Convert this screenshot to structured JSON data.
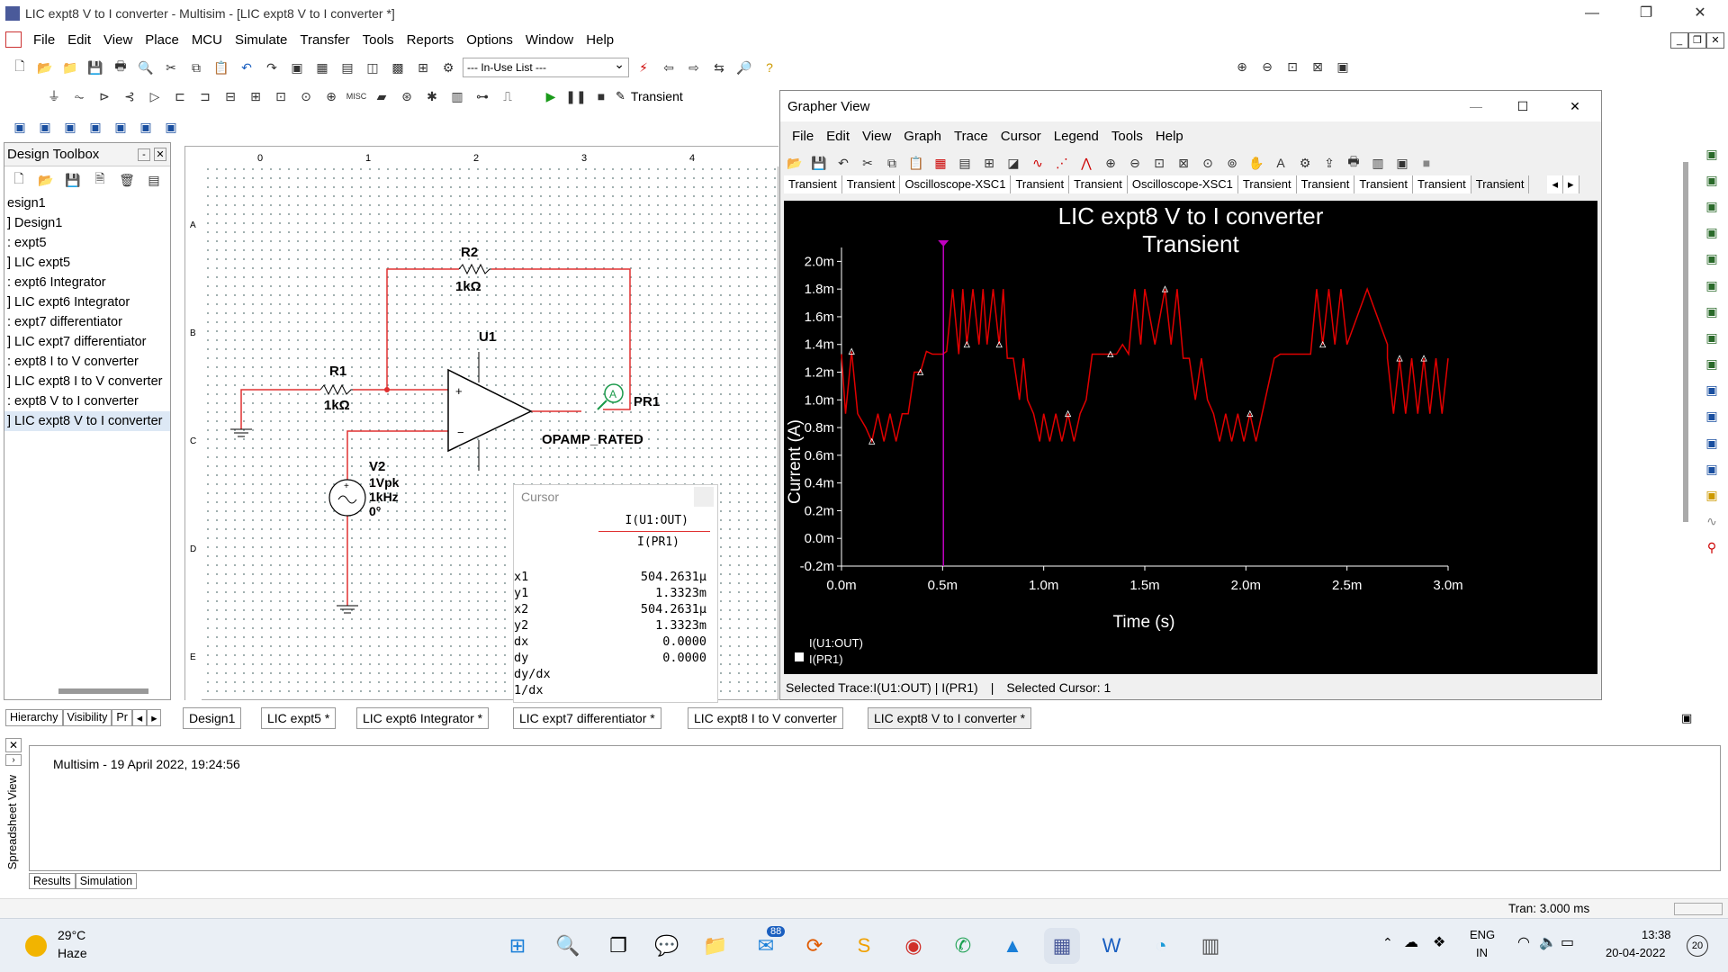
{
  "window": {
    "title": "LIC expt8 V to I converter - Multisim - [LIC expt8 V to I converter *]"
  },
  "menu": [
    "File",
    "Edit",
    "View",
    "Place",
    "MCU",
    "Simulate",
    "Transfer",
    "Tools",
    "Reports",
    "Options",
    "Window",
    "Help"
  ],
  "toolbar": {
    "inuse": "--- In-Use List ---",
    "analysis": "Transient"
  },
  "toolbox": {
    "title": "Design Toolbox",
    "items": [
      "esign1",
      "] Design1",
      ": expt5",
      "] LIC expt5",
      ": expt6 Integrator",
      "] LIC expt6 Integrator",
      ": expt7 differentiator",
      "] LIC expt7 differentiator",
      ": expt8 I to V converter",
      "] LIC expt8 I to V converter",
      ": expt8 V to I converter",
      "] LIC expt8 V to I converter"
    ],
    "tabs": [
      "Hierarchy",
      "Visibility",
      "Pr"
    ]
  },
  "schematic": {
    "r2": "R2",
    "r2v": "1kΩ",
    "r1": "R1",
    "r1v": "1kΩ",
    "u1": "U1",
    "opamp": "OPAMP_RATED",
    "pr1": "PR1",
    "v2": "V2",
    "v2a": "1Vpk",
    "v2b": "1kHz",
    "v2c": "0°",
    "probe": "A",
    "rulers": [
      "0",
      "1",
      "2",
      "3",
      "4"
    ],
    "rows": [
      "A",
      "B",
      "C",
      "D",
      "E"
    ]
  },
  "cursor": {
    "title": "Cursor",
    "col1": "I(U1:OUT)",
    "col2": "I(PR1)",
    "rows": [
      {
        "k": "x1",
        "v": "504.2631µ"
      },
      {
        "k": "y1",
        "v": "1.3323m"
      },
      {
        "k": "x2",
        "v": "504.2631µ"
      },
      {
        "k": "y2",
        "v": "1.3323m"
      },
      {
        "k": "dx",
        "v": "0.0000"
      },
      {
        "k": "dy",
        "v": "0.0000"
      },
      {
        "k": "dy/dx",
        "v": ""
      },
      {
        "k": "1/dx",
        "v": ""
      }
    ]
  },
  "grapher": {
    "title": "Grapher View",
    "menu": [
      "File",
      "Edit",
      "View",
      "Graph",
      "Trace",
      "Cursor",
      "Legend",
      "Tools",
      "Help"
    ],
    "tabs": [
      "Transient",
      "Transient",
      "Oscilloscope-XSC1",
      "Transient",
      "Transient",
      "Oscilloscope-XSC1",
      "Transient",
      "Transient",
      "Transient",
      "Transient",
      "Transient"
    ],
    "status1": "Selected Trace:I(U1:OUT) | I(PR1)",
    "status2": "Selected Cursor: 1",
    "legend1": "I(U1:OUT)",
    "legend2": "I(PR1)"
  },
  "chart_data": {
    "type": "line",
    "title": "LIC expt8 V to I converter",
    "subtitle": "Transient",
    "xlabel": "Time (s)",
    "ylabel": "Current (A)",
    "xlim": [
      0,
      0.003
    ],
    "ylim": [
      -0.0002,
      0.0021
    ],
    "xticks": [
      "0.0m",
      "0.5m",
      "1.0m",
      "1.5m",
      "2.0m",
      "2.5m",
      "3.0m"
    ],
    "yticks": [
      "2.0m",
      "1.8m",
      "1.6m",
      "1.4m",
      "1.2m",
      "1.0m",
      "0.8m",
      "0.6m",
      "0.4m",
      "0.2m",
      "0.0m",
      "-0.2m"
    ],
    "cursor_x": 0.000504,
    "series": [
      {
        "name": "I(U1:OUT)",
        "x": [
          0,
          2e-05,
          5e-05,
          8e-05,
          0.00012,
          0.00015,
          0.00018,
          0.00021,
          0.00024,
          0.00027,
          0.0003,
          0.00033,
          0.00036,
          0.00039,
          0.00042,
          0.00045,
          0.00048,
          0.0005,
          0.00052,
          0.00055,
          0.00058,
          0.0006,
          0.00062,
          0.00065,
          0.00068,
          0.0007,
          0.00072,
          0.00075,
          0.00078,
          0.0008,
          0.00082,
          0.00085,
          0.00088,
          0.0009,
          0.00092,
          0.00095,
          0.00098,
          0.001,
          0.00103,
          0.00106,
          0.00109,
          0.00112,
          0.00115,
          0.00118,
          0.00121,
          0.00124,
          0.00127,
          0.0013,
          0.00133,
          0.00136,
          0.00139,
          0.00142,
          0.00145,
          0.00148,
          0.0015,
          0.00155,
          0.0016,
          0.00163,
          0.00166,
          0.00169,
          0.00172,
          0.00175,
          0.00178,
          0.00181,
          0.00184,
          0.00187,
          0.0019,
          0.00193,
          0.00196,
          0.00199,
          0.00202,
          0.00205,
          0.00208,
          0.00211,
          0.00214,
          0.00217,
          0.0022,
          0.00223,
          0.00226,
          0.00229,
          0.00232,
          0.00235,
          0.00238,
          0.00241,
          0.00244,
          0.00247,
          0.0025,
          0.0026,
          0.0027,
          0.0027,
          0.00273,
          0.00276,
          0.00279,
          0.00282,
          0.00285,
          0.00288,
          0.00291,
          0.00294,
          0.00297,
          0.003
        ],
        "y": [
          0.00133,
          0.0009,
          0.00135,
          0.0009,
          0.0008,
          0.0007,
          0.0009,
          0.0007,
          0.0009,
          0.0007,
          0.0009,
          0.0009,
          0.0012,
          0.0012,
          0.00135,
          0.00133,
          0.00133,
          0.00133,
          0.00135,
          0.0018,
          0.00133,
          0.0018,
          0.0014,
          0.0018,
          0.0014,
          0.0018,
          0.0014,
          0.0018,
          0.0014,
          0.0018,
          0.0013,
          0.0013,
          0.001,
          0.0013,
          0.001,
          0.0009,
          0.0007,
          0.0009,
          0.0007,
          0.0009,
          0.0007,
          0.0009,
          0.0007,
          0.0009,
          0.001,
          0.00133,
          0.00133,
          0.00133,
          0.00133,
          0.00133,
          0.0014,
          0.00133,
          0.0018,
          0.0014,
          0.0018,
          0.0014,
          0.0018,
          0.0014,
          0.0018,
          0.0013,
          0.0013,
          0.001,
          0.0013,
          0.001,
          0.0009,
          0.0007,
          0.0009,
          0.0007,
          0.0009,
          0.0007,
          0.0009,
          0.0007,
          0.0009,
          0.0011,
          0.0013,
          0.00133,
          0.00133,
          0.00133,
          0.00133,
          0.00133,
          0.00133,
          0.0018,
          0.0014,
          0.0018,
          0.0014,
          0.0018,
          0.0014,
          0.0018,
          0.0014,
          0.0013,
          0.0009,
          0.0013,
          0.0009,
          0.0013,
          0.0009,
          0.0013,
          0.0009,
          0.0013,
          0.0009,
          0.0013
        ]
      }
    ]
  },
  "output": {
    "text": "Multisim  -  19 April 2022, 19:24:56",
    "tabs": [
      "Results",
      "Simulation"
    ],
    "side": "Spreadsheet View",
    "tran": "Tran: 3.000 ms"
  },
  "sheets": [
    "Design1",
    "LIC expt5 *",
    "LIC expt6 Integrator *",
    "LIC expt7 differentiator *",
    "LIC expt8 I to V converter",
    "LIC expt8 V to I converter *"
  ],
  "taskbar": {
    "temp": "29°C",
    "weather": "Haze",
    "lang1": "ENG",
    "lang2": "IN",
    "time": "13:38",
    "date": "20-04-2022",
    "badge": "88",
    "notif": "20"
  },
  "colors": {
    "wire": "#e03030",
    "trace": "#e00000",
    "cursor": "#c000c0",
    "plotbg": "#000000"
  }
}
